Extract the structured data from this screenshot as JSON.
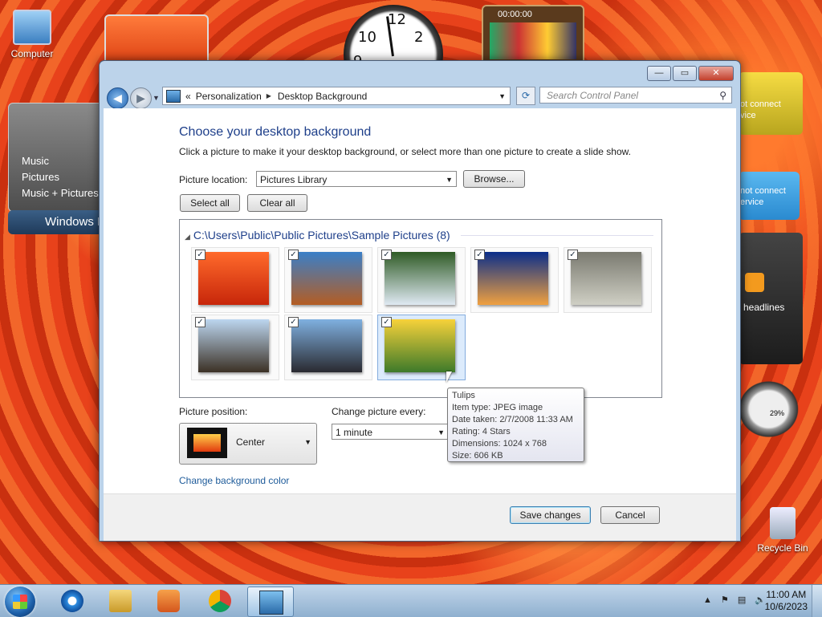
{
  "desktop": {
    "icons": [
      {
        "label": "Computer"
      },
      {
        "label": "Recycle Bin"
      }
    ],
    "gadgets": {
      "puzzle_time": "00:00:00",
      "slideshow_items": [
        "Music",
        "Pictures",
        "Music + Pictures"
      ],
      "windows_label": "Windows I",
      "weather_text_1": "ot connect",
      "weather_text_2": "vice",
      "currency_text_1": "not connect",
      "currency_text_2": "ervice",
      "feed_text": "headlines",
      "meter_value": "29%"
    }
  },
  "window": {
    "breadcrumbs": [
      "Personalization",
      "Desktop Background"
    ],
    "breadcrumb_prefix": "«",
    "search_placeholder": "Search Control Panel",
    "caption_buttons": {
      "minimize": "—",
      "maximize": "▭",
      "close": "✕"
    },
    "heading": "Choose your desktop background",
    "subheading": "Click a picture to make it your desktop background, or select more than one picture to create a slide show.",
    "picture_location_label": "Picture location:",
    "picture_location_value": "Pictures Library",
    "browse_label": "Browse...",
    "select_all_label": "Select all",
    "clear_all_label": "Clear all",
    "gallery_group_title": "C:\\Users\\Public\\Public Pictures\\Sample Pictures (8)",
    "thumbnails": [
      {
        "checked": true,
        "icon": "chrysanthemum",
        "colors": [
          "#ff6a2b",
          "#c7260a"
        ]
      },
      {
        "checked": true,
        "icon": "desert",
        "colors": [
          "#3a7fc8",
          "#b45d23"
        ]
      },
      {
        "checked": true,
        "icon": "hydrangeas",
        "colors": [
          "#2f5b25",
          "#dfe9f3"
        ]
      },
      {
        "checked": true,
        "icon": "jellyfish",
        "colors": [
          "#0a2e8a",
          "#f0a040"
        ]
      },
      {
        "checked": true,
        "icon": "koala",
        "colors": [
          "#7a7a70",
          "#cfcfc4"
        ]
      },
      {
        "checked": true,
        "icon": "lighthouse",
        "colors": [
          "#bcd6f0",
          "#3c3125"
        ]
      },
      {
        "checked": true,
        "icon": "penguins",
        "colors": [
          "#7fb0e0",
          "#2a2a30"
        ]
      },
      {
        "checked": true,
        "icon": "tulips",
        "colors": [
          "#f7d23a",
          "#3d7a2a"
        ],
        "selected": true
      }
    ],
    "picture_position_label": "Picture position:",
    "picture_position_value": "Center",
    "change_every_label": "Change picture every:",
    "change_every_value": "1 minute",
    "change_bg_color_link": "Change background color",
    "save_label": "Save changes",
    "cancel_label": "Cancel"
  },
  "tooltip": {
    "lines": [
      "Tulips",
      "Item type: JPEG image",
      "Date taken: 2/7/2008 11:33 AM",
      "Rating: 4 Stars",
      "Dimensions: 1024 x 768",
      "Size: 606 KB"
    ]
  },
  "taskbar": {
    "items": [
      {
        "icon": "internet-explorer-icon"
      },
      {
        "icon": "file-explorer-icon"
      },
      {
        "icon": "media-player-icon"
      },
      {
        "icon": "chrome-icon"
      },
      {
        "icon": "control-panel-icon",
        "active": true
      }
    ],
    "time": "11:00 AM",
    "date": "10/6/2023",
    "tray_expand": "▲"
  }
}
